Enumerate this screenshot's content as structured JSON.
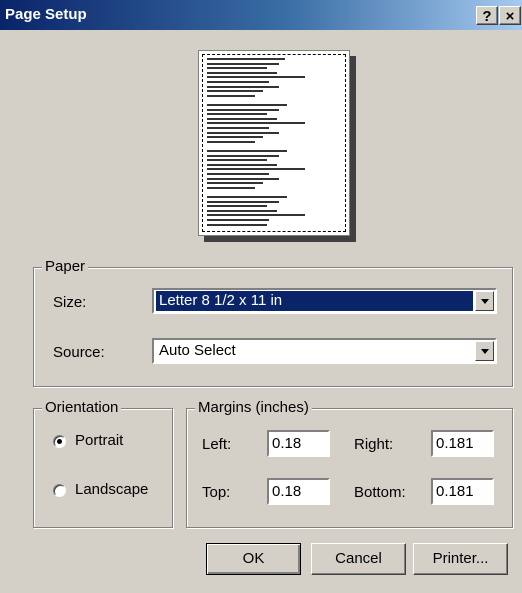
{
  "window": {
    "title": "Page Setup",
    "help_label": "?",
    "close_label": "×"
  },
  "paper": {
    "legend": "Paper",
    "size_label": "Size:",
    "size_value": "Letter 8 1/2 x 11 in",
    "source_label": "Source:",
    "source_value": "Auto Select"
  },
  "orientation": {
    "legend": "Orientation",
    "portrait_label": "Portrait",
    "landscape_label": "Landscape",
    "selected": "Portrait"
  },
  "margins": {
    "legend": "Margins (inches)",
    "left_label": "Left:",
    "left_value": "0.18",
    "right_label": "Right:",
    "right_value": "0.181",
    "top_label": "Top:",
    "top_value": "0.18",
    "bottom_label": "Bottom:",
    "bottom_value": "0.181"
  },
  "buttons": {
    "ok": "OK",
    "cancel": "Cancel",
    "printer": "Printer..."
  }
}
